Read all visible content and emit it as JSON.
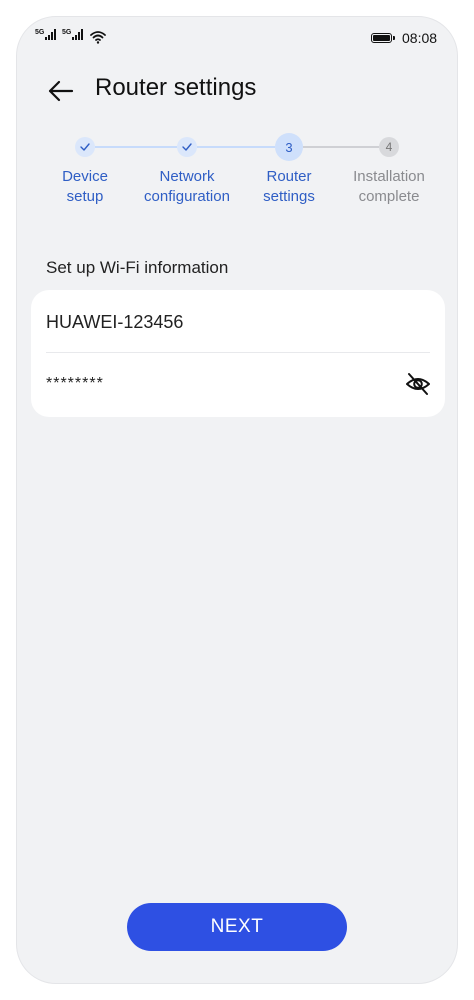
{
  "status_bar": {
    "network_1": "5G",
    "network_2": "5G",
    "time": "08:08"
  },
  "header": {
    "title": "Router settings"
  },
  "stepper": {
    "steps": [
      {
        "marker": "",
        "label": "Device\nsetup",
        "state": "done"
      },
      {
        "marker": "",
        "label": "Network\nconfiguration",
        "state": "done"
      },
      {
        "marker": "3",
        "label": "Router\nsettings",
        "state": "current"
      },
      {
        "marker": "4",
        "label": "Installation\ncomplete",
        "state": "todo"
      }
    ],
    "step1_line1": "Device",
    "step1_line2": "setup",
    "step2_line1": "Network",
    "step2_line2": "configuration",
    "step3_line1": "Router",
    "step3_line2": "settings",
    "step4_line1": "Installation",
    "step4_line2": "complete",
    "step3_marker": "3",
    "step4_marker": "4"
  },
  "wifi_form": {
    "section_label": "Set up Wi-Fi information",
    "ssid_value": "HUAWEI-123456",
    "password_value": "********"
  },
  "actions": {
    "next_label": "NEXT"
  },
  "colors": {
    "accent": "#2e50e3",
    "step_blue": "#2f5ec5",
    "background": "#f1f2f4"
  }
}
